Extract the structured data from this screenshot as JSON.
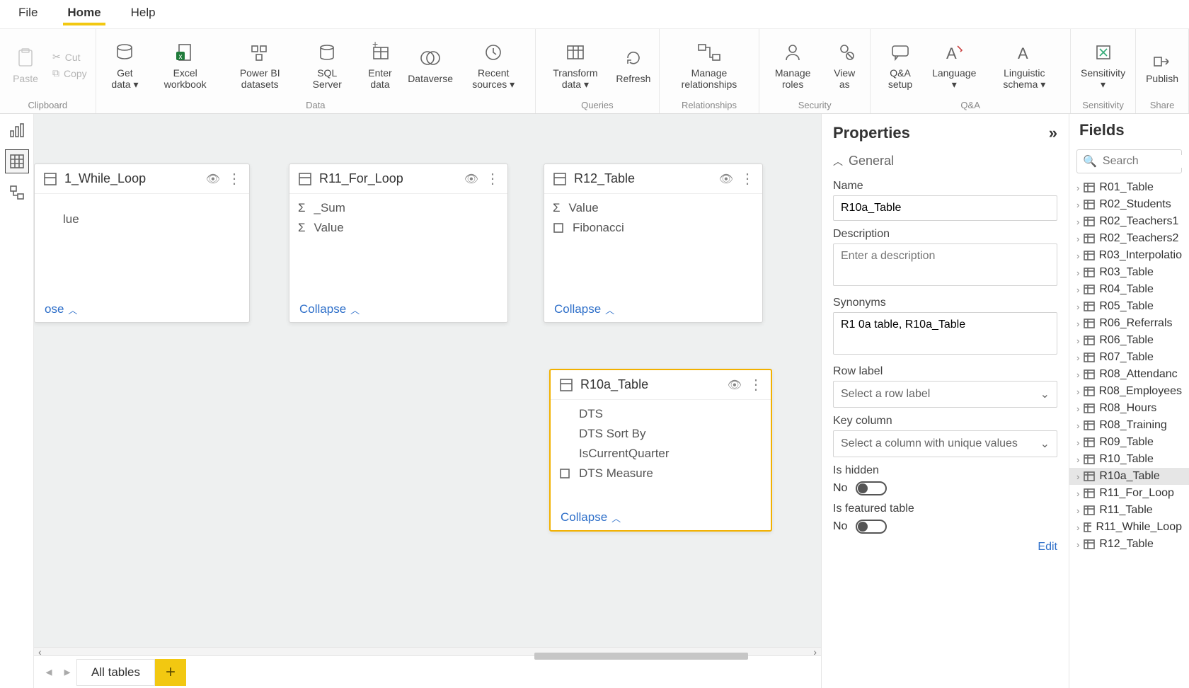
{
  "menu": {
    "file": "File",
    "home": "Home",
    "help": "Help"
  },
  "clipboard": {
    "paste": "Paste",
    "cut": "Cut",
    "copy": "Copy",
    "group": "Clipboard"
  },
  "ribbon": {
    "data": {
      "group": "Data",
      "getdata": "Get data ▾",
      "excel": "Excel workbook",
      "pbids": "Power BI datasets",
      "sql": "SQL Server",
      "enter": "Enter data",
      "dataverse": "Dataverse",
      "recent": "Recent sources ▾"
    },
    "queries": {
      "group": "Queries",
      "transform": "Transform data ▾",
      "refresh": "Refresh"
    },
    "rel": {
      "group": "Relationships",
      "manage": "Manage relationships"
    },
    "sec": {
      "group": "Security",
      "roles": "Manage roles",
      "viewas": "View as"
    },
    "qa": {
      "group": "Q&A",
      "setup": "Q&A setup",
      "lang": "Language ▾",
      "ling": "Linguistic schema ▾"
    },
    "sens": {
      "group": "Sensitivity",
      "btn": "Sensitivity ▾"
    },
    "share": {
      "group": "Share",
      "publish": "Publish"
    }
  },
  "cards": {
    "c1": {
      "title": "1_While_Loop",
      "rows": [
        "",
        "",
        "lue"
      ],
      "collapse": "ose"
    },
    "c2": {
      "title": "R11_For_Loop",
      "rows": [
        "_Sum",
        "Value"
      ],
      "collapse": "Collapse"
    },
    "c3": {
      "title": "R12_Table",
      "rows": [
        "Value",
        "Fibonacci"
      ],
      "collapse": "Collapse"
    },
    "c4": {
      "title": "R10a_Table",
      "rows": [
        "DTS",
        "DTS Sort By",
        "IsCurrentQuarter",
        "DTS Measure"
      ],
      "collapse": "Collapse"
    }
  },
  "props": {
    "title": "Properties",
    "general": "General",
    "name_l": "Name",
    "name_v": "R10a_Table",
    "desc_l": "Description",
    "desc_ph": "Enter a description",
    "syn_l": "Synonyms",
    "syn_v": "R1 0a table, R10a_Table",
    "row_l": "Row label",
    "row_ph": "Select a row label",
    "key_l": "Key column",
    "key_ph": "Select a column with unique values",
    "hidden_l": "Is hidden",
    "hidden_v": "No",
    "feat_l": "Is featured table",
    "feat_v": "No",
    "edit": "Edit"
  },
  "fields": {
    "title": "Fields",
    "search_ph": "Search",
    "items": [
      "R01_Table",
      "R02_Students",
      "R02_Teachers1",
      "R02_Teachers2",
      "R03_Interpolatio",
      "R03_Table",
      "R04_Table",
      "R05_Table",
      "R06_Referrals",
      "R06_Table",
      "R07_Table",
      "R08_Attendanc",
      "R08_Employees",
      "R08_Hours",
      "R08_Training",
      "R09_Table",
      "R10_Table",
      "R10a_Table",
      "R11_For_Loop",
      "R11_Table",
      "R11_While_Loop",
      "R12_Table"
    ],
    "selected": "R10a_Table"
  },
  "tabs": {
    "all": "All tables"
  }
}
